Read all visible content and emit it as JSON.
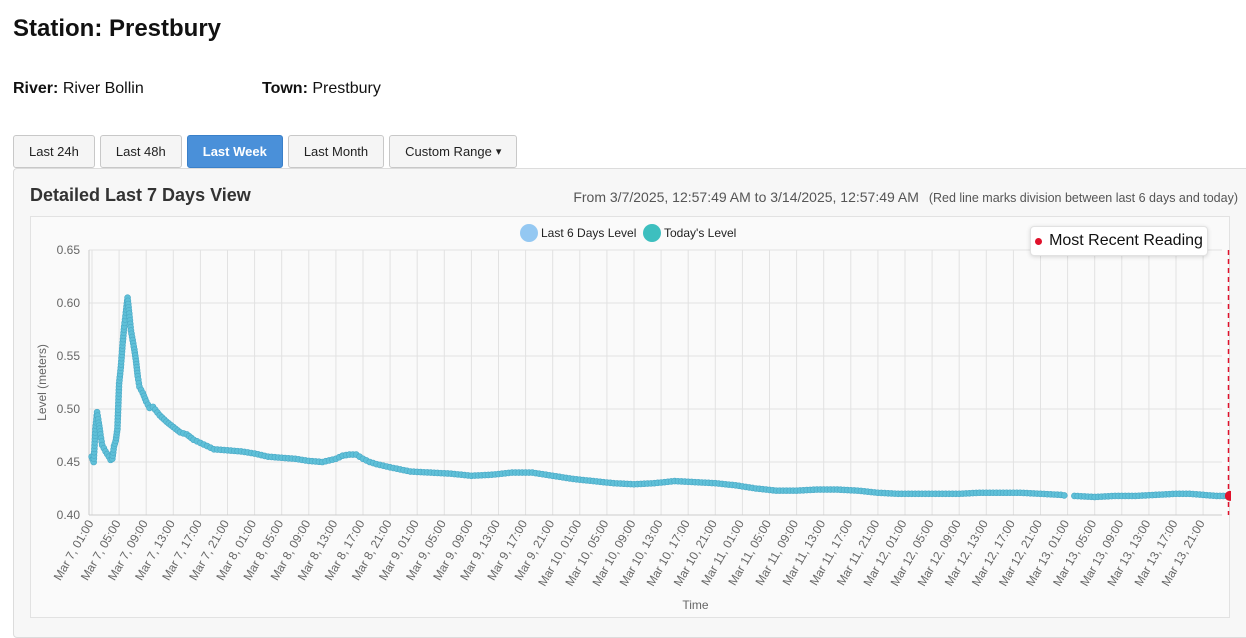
{
  "station": {
    "title": "Station: Prestbury"
  },
  "meta": {
    "river_label": "River:",
    "river_value": "River Bollin",
    "town_label": "Town:",
    "town_value": "Prestbury"
  },
  "buttons": {
    "last24": "Last 24h",
    "last48": "Last 48h",
    "lastweek": "Last Week",
    "lastmonth": "Last Month",
    "custom": "Custom Range",
    "custom_caret": "▾"
  },
  "panel": {
    "title": "Detailed Last 7 Days View",
    "range": "From 3/7/2025, 12:57:49 AM to 3/14/2025, 12:57:49 AM",
    "note": "(Red line marks division between last 6 days and today)",
    "recent_label": "Most Recent Reading"
  },
  "colors": {
    "last6": "#94c8f2",
    "today": "#3dbfbf",
    "line": "#7cc6e6",
    "point": "#5fc0d8",
    "divider": "#e0112b",
    "active_button": "#4a90d9"
  },
  "chart_data": {
    "type": "line",
    "xlabel": "Time",
    "ylabel": "Level (meters)",
    "ylim": [
      0.4,
      0.65
    ],
    "yticks": [
      "0.65",
      "0.60",
      "0.55",
      "0.50",
      "0.45",
      "0.40"
    ],
    "xticks": [
      "Mar 7, 01:00",
      "Mar 7, 05:00",
      "Mar 7, 09:00",
      "Mar 7, 13:00",
      "Mar 7, 17:00",
      "Mar 7, 21:00",
      "Mar 8, 01:00",
      "Mar 8, 05:00",
      "Mar 8, 09:00",
      "Mar 8, 13:00",
      "Mar 8, 17:00",
      "Mar 8, 21:00",
      "Mar 9, 01:00",
      "Mar 9, 05:00",
      "Mar 9, 09:00",
      "Mar 9, 13:00",
      "Mar 9, 17:00",
      "Mar 9, 21:00",
      "Mar 10, 01:00",
      "Mar 10, 05:00",
      "Mar 10, 09:00",
      "Mar 10, 13:00",
      "Mar 10, 17:00",
      "Mar 10, 21:00",
      "Mar 11, 01:00",
      "Mar 11, 05:00",
      "Mar 11, 09:00",
      "Mar 11, 13:00",
      "Mar 11, 17:00",
      "Mar 11, 21:00",
      "Mar 12, 01:00",
      "Mar 12, 05:00",
      "Mar 12, 09:00",
      "Mar 12, 13:00",
      "Mar 12, 17:00",
      "Mar 12, 21:00",
      "Mar 13, 01:00",
      "Mar 13, 05:00",
      "Mar 13, 09:00",
      "Mar 13, 13:00",
      "Mar 13, 17:00",
      "Mar 13, 21:00"
    ],
    "grid": true,
    "legend_position": "top-center",
    "series": [
      {
        "name": "Last 6 Days Level",
        "points": [
          [
            "Mar 7, 00:57",
            0.455
          ],
          [
            "Mar 7, 01:15",
            0.45
          ],
          [
            "Mar 7, 01:30",
            0.481
          ],
          [
            "Mar 7, 01:45",
            0.497
          ],
          [
            "Mar 7, 02:00",
            0.487
          ],
          [
            "Mar 7, 02:15",
            0.476
          ],
          [
            "Mar 7, 02:30",
            0.466
          ],
          [
            "Mar 7, 03:00",
            0.46
          ],
          [
            "Mar 7, 03:30",
            0.455
          ],
          [
            "Mar 7, 03:45",
            0.452
          ],
          [
            "Mar 7, 04:00",
            0.453
          ],
          [
            "Mar 7, 04:15",
            0.465
          ],
          [
            "Mar 7, 04:30",
            0.47
          ],
          [
            "Mar 7, 04:45",
            0.481
          ],
          [
            "Mar 7, 05:00",
            0.524
          ],
          [
            "Mar 7, 05:15",
            0.539
          ],
          [
            "Mar 7, 05:30",
            0.56
          ],
          [
            "Mar 7, 05:45",
            0.578
          ],
          [
            "Mar 7, 06:00",
            0.591
          ],
          [
            "Mar 7, 06:15",
            0.605
          ],
          [
            "Mar 7, 06:30",
            0.59
          ],
          [
            "Mar 7, 06:45",
            0.574
          ],
          [
            "Mar 7, 07:00",
            0.565
          ],
          [
            "Mar 7, 07:15",
            0.556
          ],
          [
            "Mar 7, 07:30",
            0.545
          ],
          [
            "Mar 7, 07:45",
            0.531
          ],
          [
            "Mar 7, 08:00",
            0.521
          ],
          [
            "Mar 7, 08:30",
            0.515
          ],
          [
            "Mar 7, 09:00",
            0.507
          ],
          [
            "Mar 7, 09:30",
            0.501
          ],
          [
            "Mar 7, 10:00",
            0.502
          ],
          [
            "Mar 7, 11:00",
            0.494
          ],
          [
            "Mar 7, 12:00",
            0.488
          ],
          [
            "Mar 7, 13:00",
            0.483
          ],
          [
            "Mar 7, 14:00",
            0.478
          ],
          [
            "Mar 7, 15:00",
            0.476
          ],
          [
            "Mar 7, 16:00",
            0.471
          ],
          [
            "Mar 7, 17:00",
            0.468
          ],
          [
            "Mar 7, 18:00",
            0.465
          ],
          [
            "Mar 7, 19:00",
            0.462
          ],
          [
            "Mar 7, 21:00",
            0.461
          ],
          [
            "Mar 7, 23:00",
            0.46
          ],
          [
            "Mar 8, 01:00",
            0.458
          ],
          [
            "Mar 8, 03:00",
            0.455
          ],
          [
            "Mar 8, 05:00",
            0.454
          ],
          [
            "Mar 8, 07:00",
            0.453
          ],
          [
            "Mar 8, 09:00",
            0.451
          ],
          [
            "Mar 8, 11:00",
            0.45
          ],
          [
            "Mar 8, 13:00",
            0.453
          ],
          [
            "Mar 8, 14:00",
            0.456
          ],
          [
            "Mar 8, 15:00",
            0.457
          ],
          [
            "Mar 8, 16:00",
            0.457
          ],
          [
            "Mar 8, 17:00",
            0.453
          ],
          [
            "Mar 8, 18:00",
            0.45
          ],
          [
            "Mar 8, 19:00",
            0.448
          ],
          [
            "Mar 8, 21:00",
            0.445
          ],
          [
            "Mar 9, 00:00",
            0.441
          ],
          [
            "Mar 9, 03:00",
            0.44
          ],
          [
            "Mar 9, 06:00",
            0.439
          ],
          [
            "Mar 9, 09:00",
            0.437
          ],
          [
            "Mar 9, 12:00",
            0.438
          ],
          [
            "Mar 9, 15:00",
            0.44
          ],
          [
            "Mar 9, 18:00",
            0.44
          ],
          [
            "Mar 9, 21:00",
            0.437
          ],
          [
            "Mar 10, 00:00",
            0.434
          ],
          [
            "Mar 10, 03:00",
            0.432
          ],
          [
            "Mar 10, 06:00",
            0.43
          ],
          [
            "Mar 10, 09:00",
            0.429
          ],
          [
            "Mar 10, 12:00",
            0.43
          ],
          [
            "Mar 10, 15:00",
            0.432
          ],
          [
            "Mar 10, 18:00",
            0.431
          ],
          [
            "Mar 10, 21:00",
            0.43
          ],
          [
            "Mar 11, 00:00",
            0.428
          ],
          [
            "Mar 11, 03:00",
            0.425
          ],
          [
            "Mar 11, 06:00",
            0.423
          ],
          [
            "Mar 11, 09:00",
            0.423
          ],
          [
            "Mar 11, 12:00",
            0.424
          ],
          [
            "Mar 11, 15:00",
            0.424
          ],
          [
            "Mar 11, 18:00",
            0.423
          ],
          [
            "Mar 11, 21:00",
            0.421
          ],
          [
            "Mar 12, 00:00",
            0.42
          ],
          [
            "Mar 12, 03:00",
            0.42
          ],
          [
            "Mar 12, 06:00",
            0.42
          ],
          [
            "Mar 12, 09:00",
            0.42
          ],
          [
            "Mar 12, 12:00",
            0.421
          ],
          [
            "Mar 12, 15:00",
            0.421
          ],
          [
            "Mar 12, 18:00",
            0.421
          ],
          [
            "Mar 12, 21:00",
            0.42
          ],
          [
            "Mar 13, 00:00",
            0.419
          ],
          [
            "Mar 13, 01:00",
            0.418
          ]
        ]
      },
      {
        "name": "Today's Level",
        "points": [
          [
            "Mar 13, 02:00",
            0.418
          ],
          [
            "Mar 13, 05:00",
            0.417
          ],
          [
            "Mar 13, 08:00",
            0.418
          ],
          [
            "Mar 13, 11:00",
            0.418
          ],
          [
            "Mar 13, 14:00",
            0.419
          ],
          [
            "Mar 13, 17:00",
            0.42
          ],
          [
            "Mar 13, 19:00",
            0.42
          ],
          [
            "Mar 13, 21:00",
            0.419
          ],
          [
            "Mar 13, 23:00",
            0.418
          ],
          [
            "Mar 14, 00:57",
            0.418
          ]
        ]
      }
    ],
    "annotations": [
      {
        "type": "vertical-line",
        "x": "Mar 14, 00:45",
        "style": "dashed",
        "color": "#e0112b",
        "label": "division between last 6 days and today"
      },
      {
        "type": "point",
        "x": "Mar 14, 00:57",
        "y": 0.418,
        "label": "Most Recent Reading"
      }
    ]
  }
}
